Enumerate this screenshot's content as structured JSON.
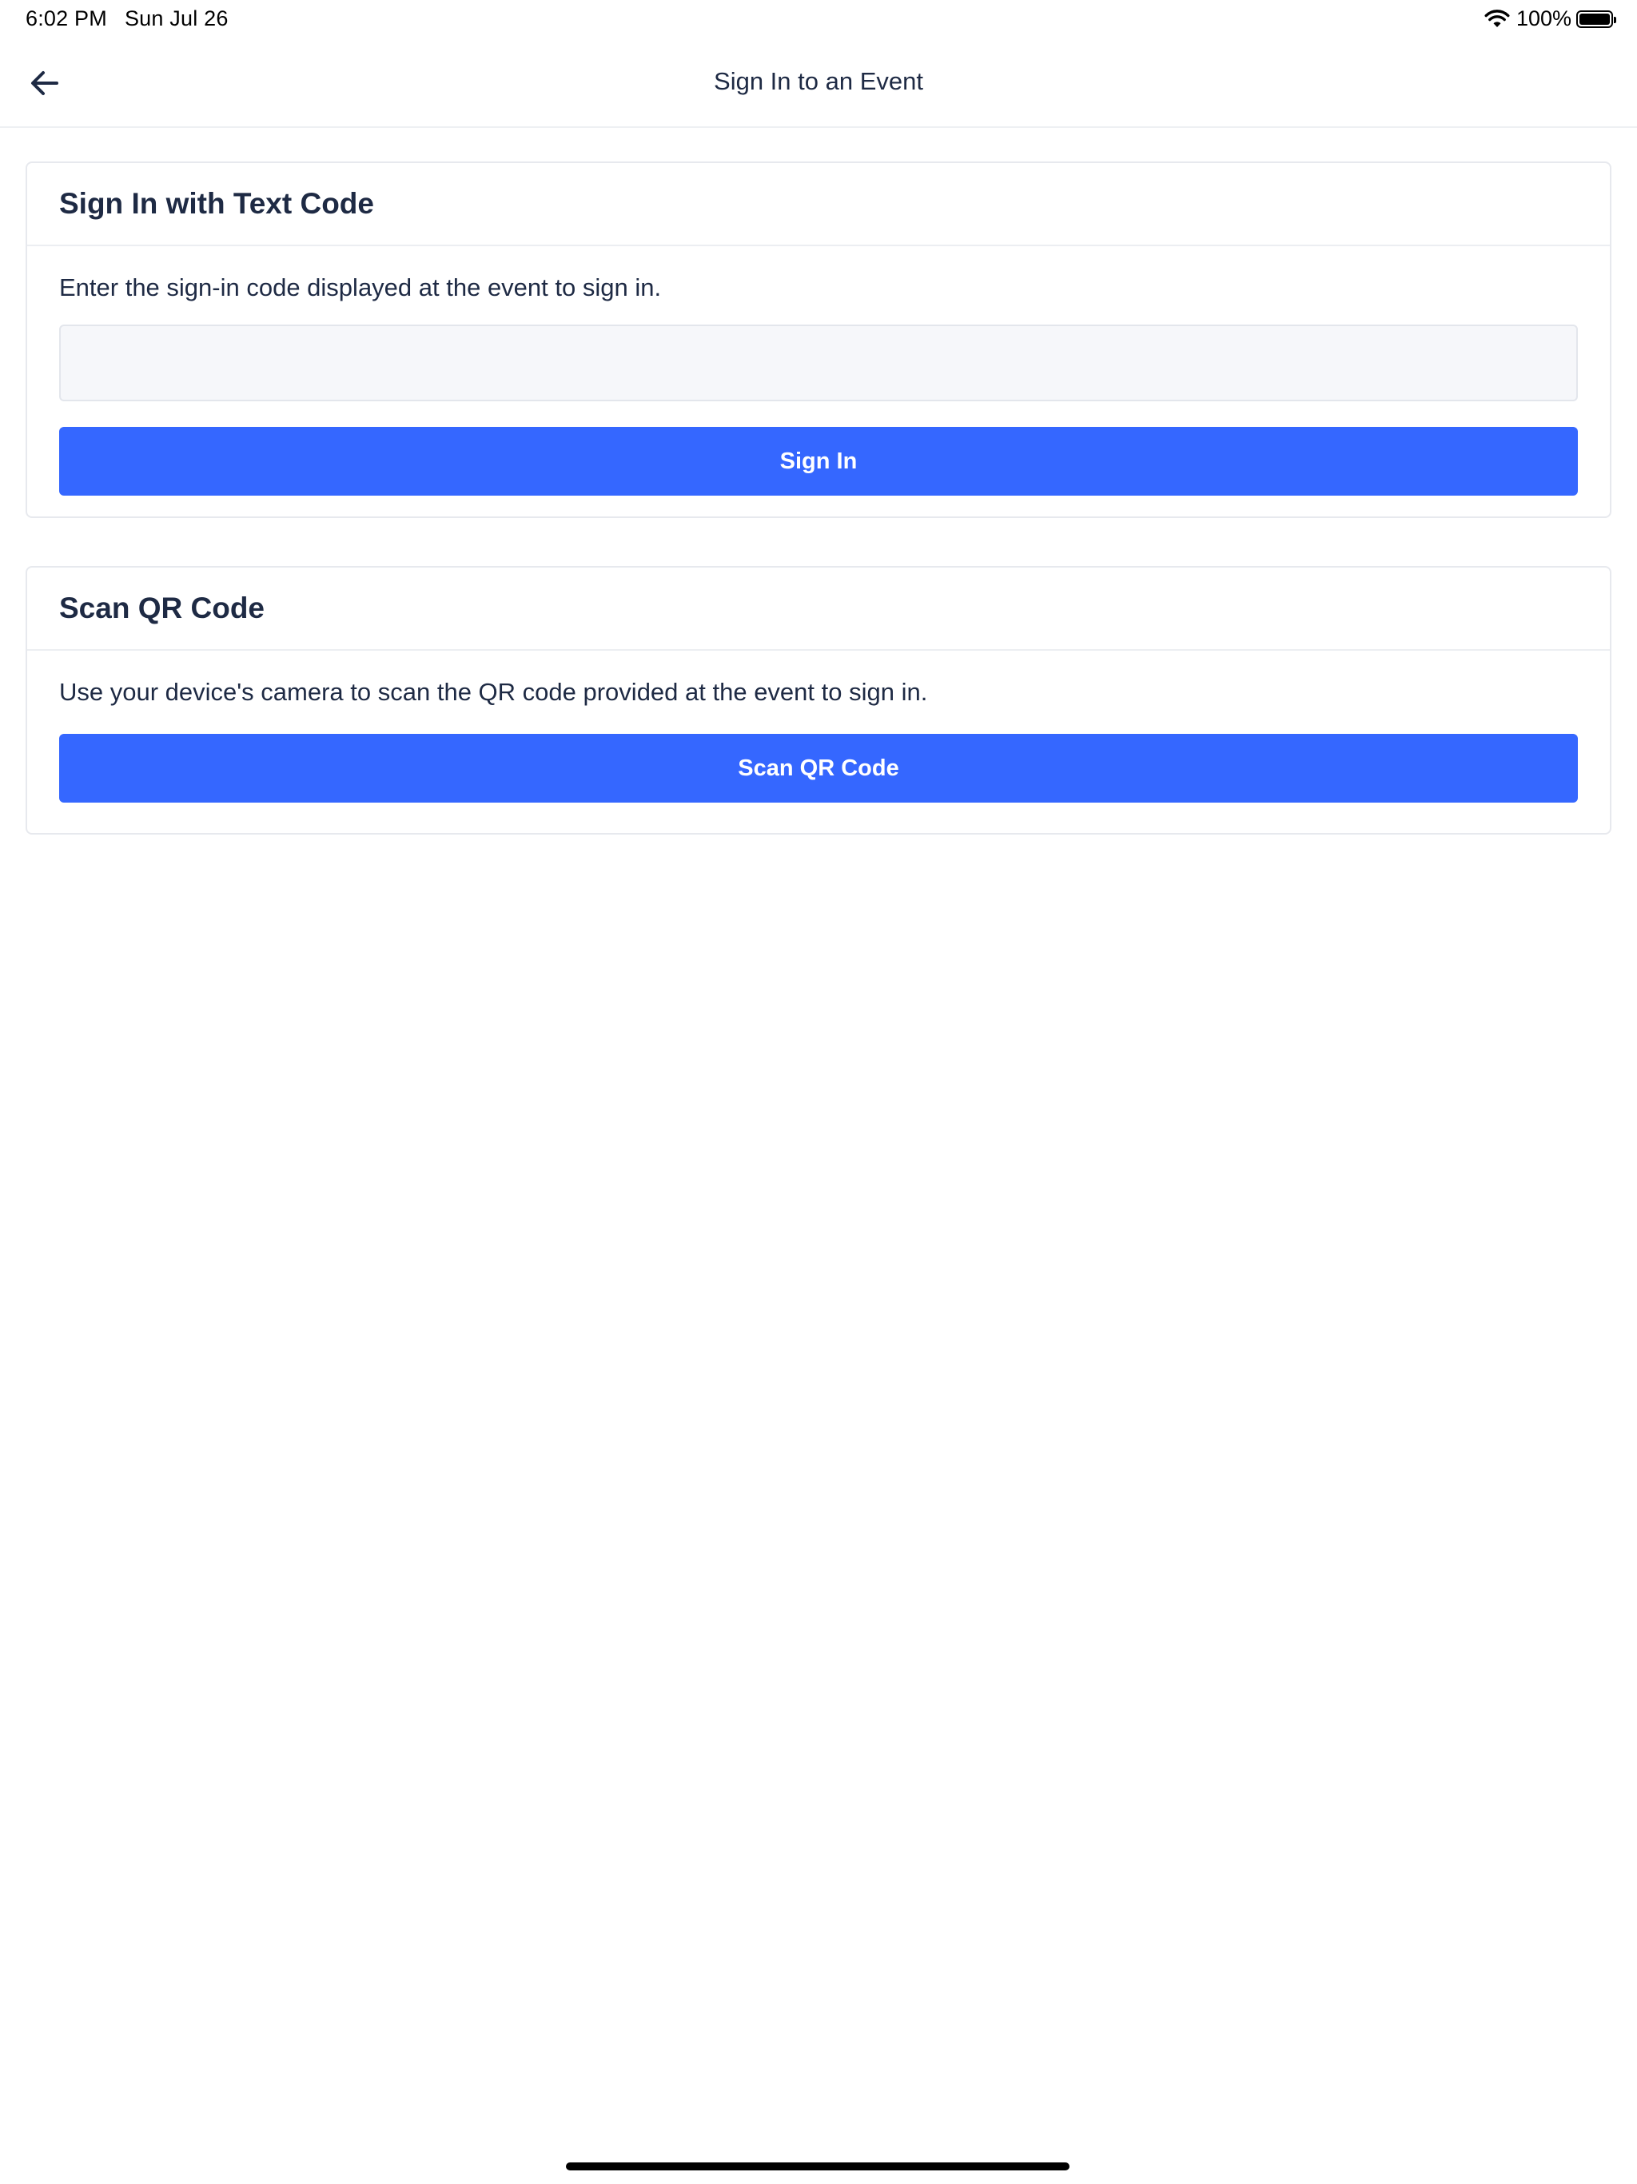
{
  "status_bar": {
    "time": "6:02 PM",
    "date": "Sun Jul 26",
    "battery_percent": "100%",
    "wifi_icon": "wifi-icon",
    "battery_icon": "battery-icon"
  },
  "nav": {
    "back_icon": "arrow-left-icon",
    "title": "Sign In to an Event"
  },
  "text_code_card": {
    "title": "Sign In with Text Code",
    "description": "Enter the sign-in code displayed at the event to sign in.",
    "input_value": "",
    "input_placeholder": "",
    "button_label": "Sign In",
    "button_color": "#3567ff"
  },
  "qr_card": {
    "title": "Scan QR Code",
    "description": "Use your device's camera to scan the QR code provided at the event to sign in.",
    "button_label": "Scan QR Code",
    "button_color": "#3567ff"
  }
}
